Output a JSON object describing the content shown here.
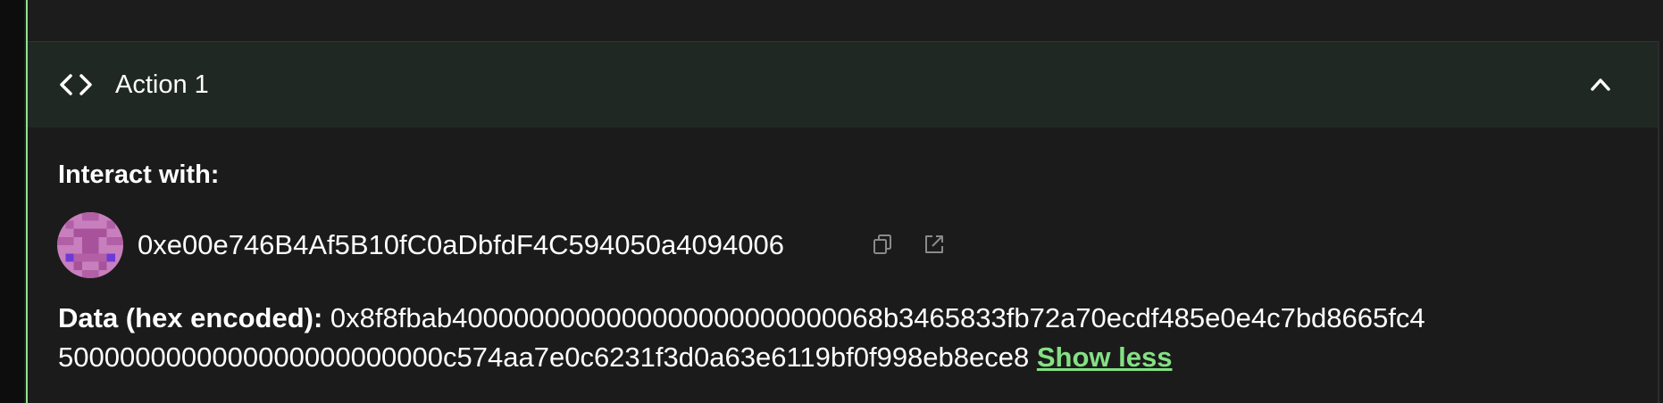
{
  "action": {
    "title": "Action 1",
    "expanded": true
  },
  "interact": {
    "label": "Interact with:",
    "address": "0xe00e746B4Af5B10fC0aDbfdF4C594050a4094006"
  },
  "data": {
    "label": "Data (hex encoded):",
    "line1": "0x8f8fbab4000000000000000000000000068b3465833fb72a70ecdf485e0e4c7bd8665fc4",
    "line2": "5000000000000000000000000c574aa7e0c6231f3d0a63e6119bf0f998eb8ece8",
    "toggle_label": "Show less"
  },
  "colors": {
    "accent": "#84e183",
    "header_bg": "#202824",
    "page_bg": "#1b1b1b"
  }
}
